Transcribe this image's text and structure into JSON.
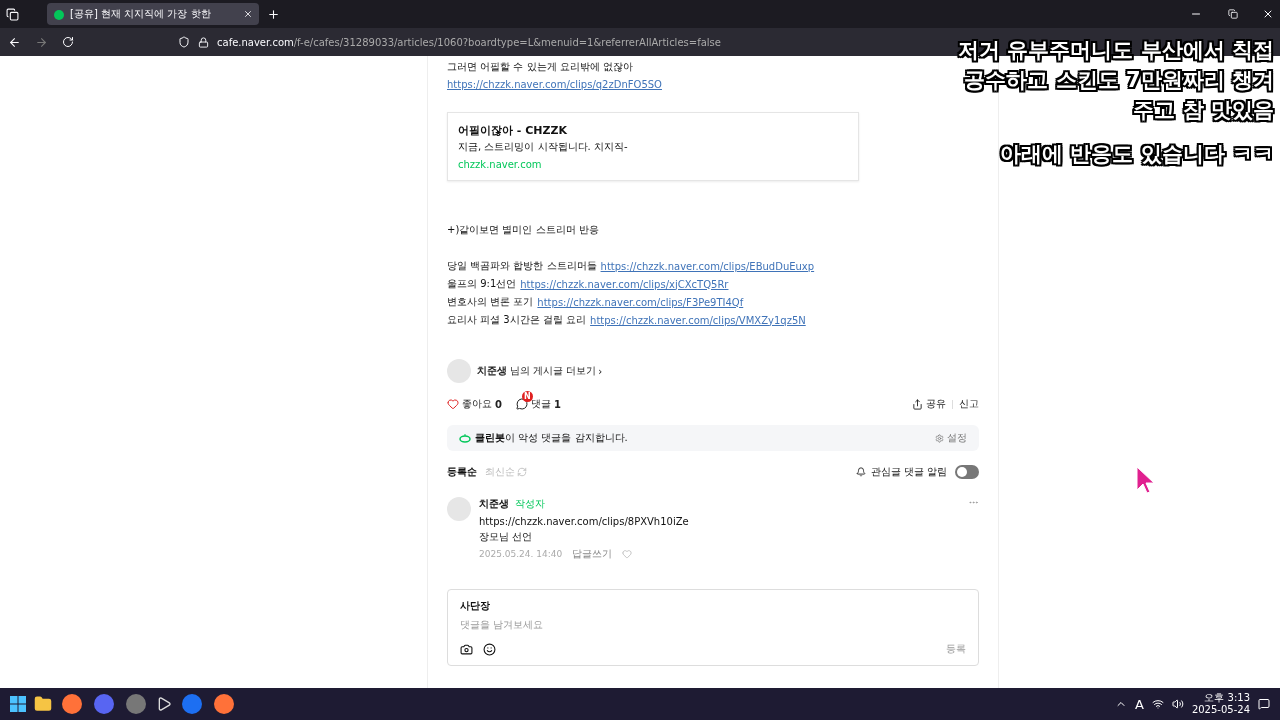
{
  "browser": {
    "tab": {
      "title": "[공유] 현재 치지직에 가장 핫한",
      "selected": true
    },
    "url": {
      "host": "cafe.naver.com",
      "path": "/f-e/cafes/31289033/articles/1060?boardtype=L&menuid=1&referrerAllArticles=false"
    }
  },
  "article": {
    "first_line": "그러면 어필할 수 있는게 요리밖에 없잖아",
    "first_link": "https://chzzk.naver.com/clips/q2zDnFO5SO",
    "embed": {
      "title": "어필이잖아 - CHZZK",
      "description": "지금, 스트리밍이 시작됩니다. 치지직-",
      "domain": "chzzk.naver.com"
    },
    "reaction_heading": "+)같이보면 별미인 스트리머 반응",
    "clips": [
      {
        "text": "당일 백곰파와 합방한 스트리머들",
        "url": "https://chzzk.naver.com/clips/EBudDuEuxp"
      },
      {
        "text": "울프의 9:1선언",
        "url": "https://chzzk.naver.com/clips/xjCXcTQ5Rr"
      },
      {
        "text": "변호사의 변론 포기",
        "url": "https://chzzk.naver.com/clips/F3Pe9TI4Qf"
      },
      {
        "text": "요리사 피셜 3시간은 걸릴 요리",
        "url": "https://chzzk.naver.com/clips/VMXZy1qz5N"
      }
    ]
  },
  "author_more": {
    "name": "치준생",
    "suffix": "님의 게시글 더보기",
    "arrow": "›"
  },
  "actions": {
    "like_label": "좋아요",
    "like_count": "0",
    "comment_label": "댓글",
    "comment_count": "1",
    "new_badge": "N",
    "share": "공유",
    "report": "신고"
  },
  "cleanbot": {
    "text": "**클린봇**이 악성 댓글을 감지합니다.",
    "settings": "설정"
  },
  "sort": {
    "options": [
      {
        "label": "등록순",
        "selected": true
      },
      {
        "label": "최신순",
        "selected": false
      }
    ],
    "notify_label": "관심글 댓글 알림",
    "notify_on": false
  },
  "comments": [
    {
      "author": "치준생",
      "badge": "작성자",
      "lines": [
        "https://chzzk.naver.com/clips/8PXVh10iZe",
        "장모님 선언"
      ],
      "date": "2025.05.24. 14:40",
      "reply": "답글쓰기"
    }
  ],
  "composer": {
    "user": "사단장",
    "placeholder": "댓글을 남겨보세요",
    "submit": "등록"
  },
  "overlay_caption": {
    "lines": [
      "저거 유부주머니도 부산에서 칙접",
      "공수하고 스킨도 7만원짜리 챙겨",
      "주고 참 맛있음"
    ],
    "footer": "아래에 반응도 있습니다 ㅋㅋ"
  },
  "taskbar": {
    "ime": "A",
    "time": "오후 3:13",
    "date": "2025-05-24"
  }
}
